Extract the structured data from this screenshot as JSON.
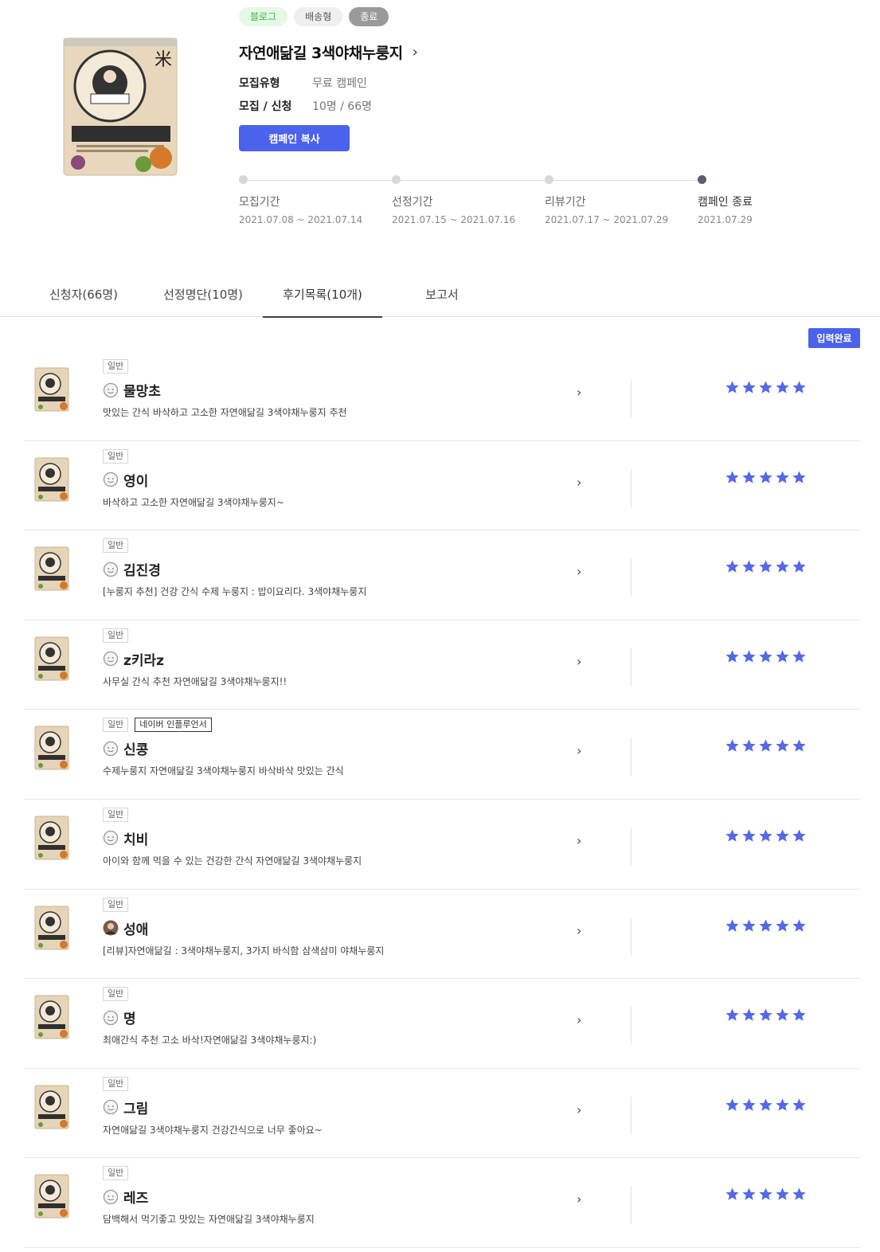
{
  "header": {
    "badges": {
      "blog": "블로그",
      "delivery": "배송형",
      "ended": "종료"
    },
    "title": "자연애닮길 3색야채누룽지",
    "recruit_type_label": "모집유형",
    "recruit_type_value": "무료 캠페인",
    "recruit_apply_label": "모집 / 신청",
    "recruit_apply_value": "10명 / 66명",
    "copy_button": "캠페인 복사",
    "timeline": [
      {
        "label": "모집기간",
        "date": "2021.07.08 ~ 2021.07.14",
        "active": false
      },
      {
        "label": "선정기간",
        "date": "2021.07.15 ~ 2021.07.16",
        "active": false
      },
      {
        "label": "리뷰기간",
        "date": "2021.07.17 ~ 2021.07.29",
        "active": false
      },
      {
        "label": "캠페인 종료",
        "date": "2021.07.29",
        "active": true
      }
    ]
  },
  "tabs": [
    {
      "label": "신청자(66명)",
      "active": false
    },
    {
      "label": "선정명단(10명)",
      "active": false
    },
    {
      "label": "후기목록(10개)",
      "active": true
    },
    {
      "label": "보고서",
      "active": false
    }
  ],
  "done_button": "입력완료",
  "reviews": [
    {
      "tags": [
        "일반"
      ],
      "name": "물망초",
      "title": "맛있는 간식 바삭하고 고소한 자연애닮길 3색야채누룽지 추천",
      "rating": 5,
      "avatar": "default"
    },
    {
      "tags": [
        "일반"
      ],
      "name": "영이",
      "title": "바삭하고 고소한 자연애닮길 3색야채누룽지~",
      "rating": 5,
      "avatar": "default"
    },
    {
      "tags": [
        "일반"
      ],
      "name": "김진경",
      "title": "[누룽지 추천] 건강 간식 수제 누룽지 : 밥이요리다. 3색야채누룽지",
      "rating": 5,
      "avatar": "default"
    },
    {
      "tags": [
        "일반"
      ],
      "name": "z키라z",
      "title": "사무실 간식 추천 자연애닮길 3색야채누룽지!!",
      "rating": 5,
      "avatar": "default"
    },
    {
      "tags": [
        "일반",
        "네이버 인플루언서"
      ],
      "name": "신콩",
      "title": "수제누룽지 자연애닮길 3색야채누룽지 바삭바삭 맛있는 간식",
      "rating": 5,
      "avatar": "default"
    },
    {
      "tags": [
        "일반"
      ],
      "name": "치비",
      "title": "아이와 함께 먹을 수 있는 건강한 간식 자연애닮길 3색야채누룽지",
      "rating": 5,
      "avatar": "default"
    },
    {
      "tags": [
        "일반"
      ],
      "name": "성애",
      "title": "[리뷰]자연애닮길 : 3색야채누룽지, 3가지 바식함 삼색삼미 야채누룽지",
      "rating": 5,
      "avatar": "photo"
    },
    {
      "tags": [
        "일반"
      ],
      "name": "명",
      "title": "최애간식 추천 고소 바삭!자연애닮길 3색야채누룽지:)",
      "rating": 5,
      "avatar": "default"
    },
    {
      "tags": [
        "일반"
      ],
      "name": "그림",
      "title": "자연애닮길 3색야채누룽지 건강간식으로 너무 좋아요~",
      "rating": 5,
      "avatar": "default"
    },
    {
      "tags": [
        "일반"
      ],
      "name": "레즈",
      "title": "담백해서 먹기좋고 맛있는 자연애닮길 3색야채누룽지",
      "rating": 5,
      "avatar": "default"
    }
  ],
  "colors": {
    "accent": "#4a62ec",
    "star": "#5468e8",
    "blog_badge": "#3ab54a"
  }
}
